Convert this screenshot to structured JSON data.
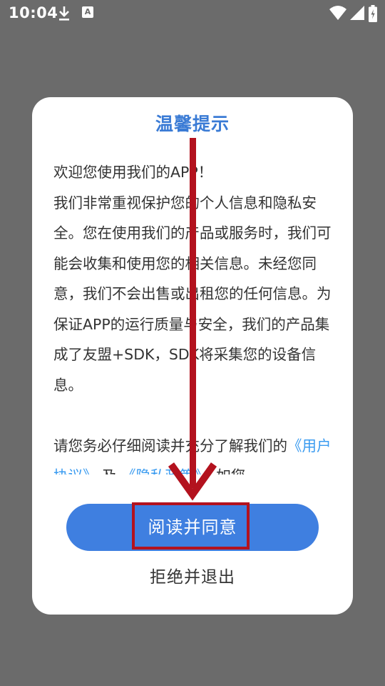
{
  "status_bar": {
    "time": "10:04",
    "app_icon_glyph": "A",
    "icons": [
      "download-icon",
      "app-notification-icon",
      "wifi-icon",
      "cell-signal-icon",
      "battery-charging-icon"
    ]
  },
  "dialog": {
    "title": "温馨提示",
    "paragraphs": [
      "欢迎您使用我们的APP！",
      "我们非常重视保护您的个人信息和隐私安全。您在使用我们的产品或服务时，我们可能会收集和使用您的相关信息。未经您同意，我们不会出售或出租您的任何信息。为保证APP的运行质量与安全，我们的产品集成了友盟+SDK，SDK将采集您的设备信息。"
    ],
    "consent_text_prefix": "请您务必仔细阅读并充分了解我们的",
    "user_agreement_link": "《用户协议》",
    "conjunction": "及",
    "privacy_policy_link": "《隐私政策》",
    "consent_text_suffix": "，如您"
  },
  "buttons": {
    "agree_label": "阅读并同意",
    "decline_label": "拒绝并退出"
  },
  "colors": {
    "accent": "#3f7fe0",
    "title": "#3a7bd5",
    "link": "#3a9bf0",
    "annotation": "#b3121e",
    "backdrop": "#6b6b6b"
  }
}
